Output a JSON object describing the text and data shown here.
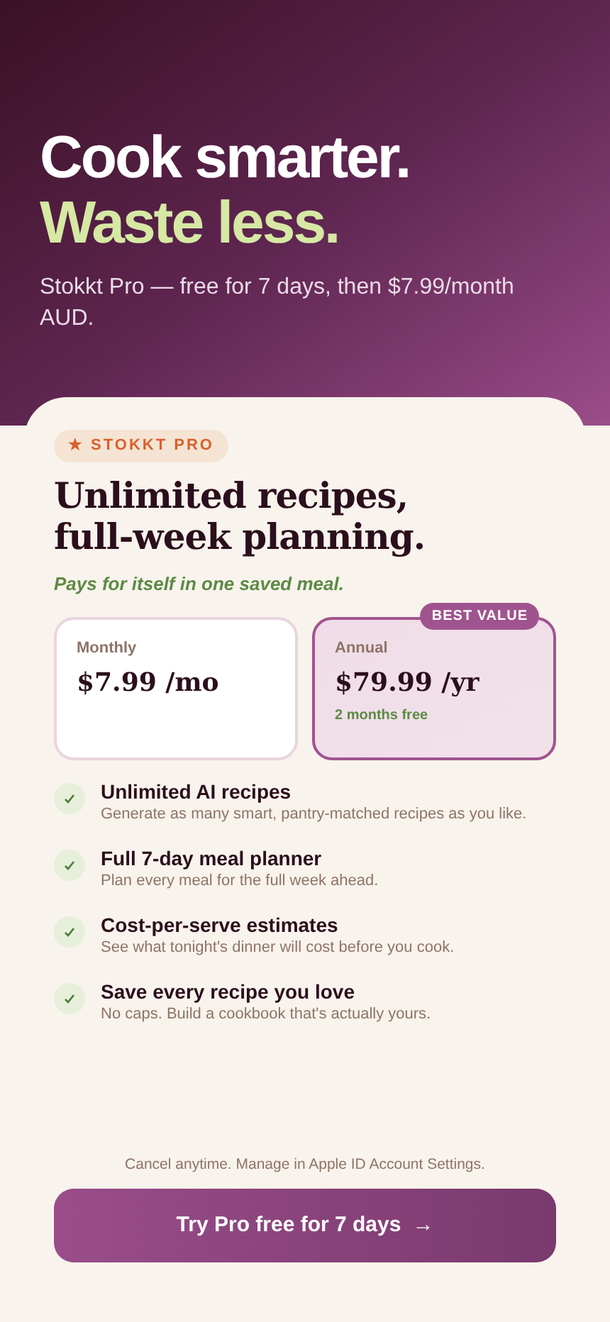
{
  "hero": {
    "title_line_1": "Cook smarter.",
    "title_line_2": "Waste less.",
    "subtitle": "Stokkt Pro — free for 7 days, then $7.99/month AUD."
  },
  "badge": "★ STOKKT PRO",
  "heading": "Unlimited recipes, full-week planning.",
  "tagline": "Pays for itself in one saved meal.",
  "plans": [
    {
      "name": "Monthly",
      "price": "$7.99 /mo",
      "selected": false
    },
    {
      "name": "Annual",
      "price": "$79.99 /yr",
      "note": "2 months free",
      "ribbon": "BEST VALUE",
      "selected": true
    }
  ],
  "features": [
    {
      "title": "Unlimited AI recipes",
      "description": "Generate as many smart, pantry-matched recipes as you like."
    },
    {
      "title": "Full 7-day meal planner",
      "description": "Plan every meal for the full week ahead."
    },
    {
      "title": "Cost-per-serve estimates",
      "description": "See what tonight's dinner will cost before you cook."
    },
    {
      "title": "Save every recipe you love",
      "description": "No caps. Build a cookbook that's actually yours."
    }
  ],
  "footer_note": "Cancel anytime. Manage in Apple ID Account Settings.",
  "cta": {
    "label": "Try Pro free for 7 days",
    "arrow": "→"
  }
}
